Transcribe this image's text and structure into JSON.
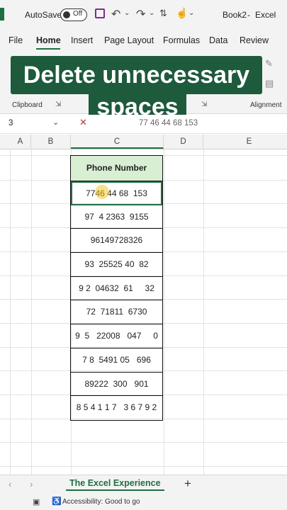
{
  "titlebar": {
    "autosave_label": "AutoSave",
    "autosave_state": "Off",
    "workbook": "Book2",
    "app": "Excel"
  },
  "menu": {
    "items": [
      "File",
      "Home",
      "Insert",
      "Page Layout",
      "Formulas",
      "Data",
      "Review"
    ],
    "active": "Home"
  },
  "banner": {
    "line1": "Delete unnecessary",
    "line2": "spaces"
  },
  "ribbon": {
    "groups": [
      "Clipboard",
      "Alignment"
    ]
  },
  "formula_bar": {
    "name_box": "3",
    "content": "77 46 44 68 153"
  },
  "columns": [
    "A",
    "B",
    "C",
    "D",
    "E"
  ],
  "table": {
    "header": "Phone Number",
    "rows": [
      "7746 44 68  153",
      "97  4 2363  9155",
      "96149728326",
      "93  25525 40  82",
      "9 2  04632  61     32",
      "72  71811  6730",
      "9  5   22008   047     0",
      "7 8  5491 05   696",
      "89222  300   901",
      "8 5 4 1 1 7   3 6 7 9 2"
    ]
  },
  "sheets": {
    "tab": "The Excel Experience",
    "add": "+"
  },
  "status": {
    "accessibility": "Accessibility: Good to go"
  },
  "colors": {
    "brand": "#1f6f43",
    "banner": "#1e5a3c",
    "header_fill": "#d9efd3"
  }
}
